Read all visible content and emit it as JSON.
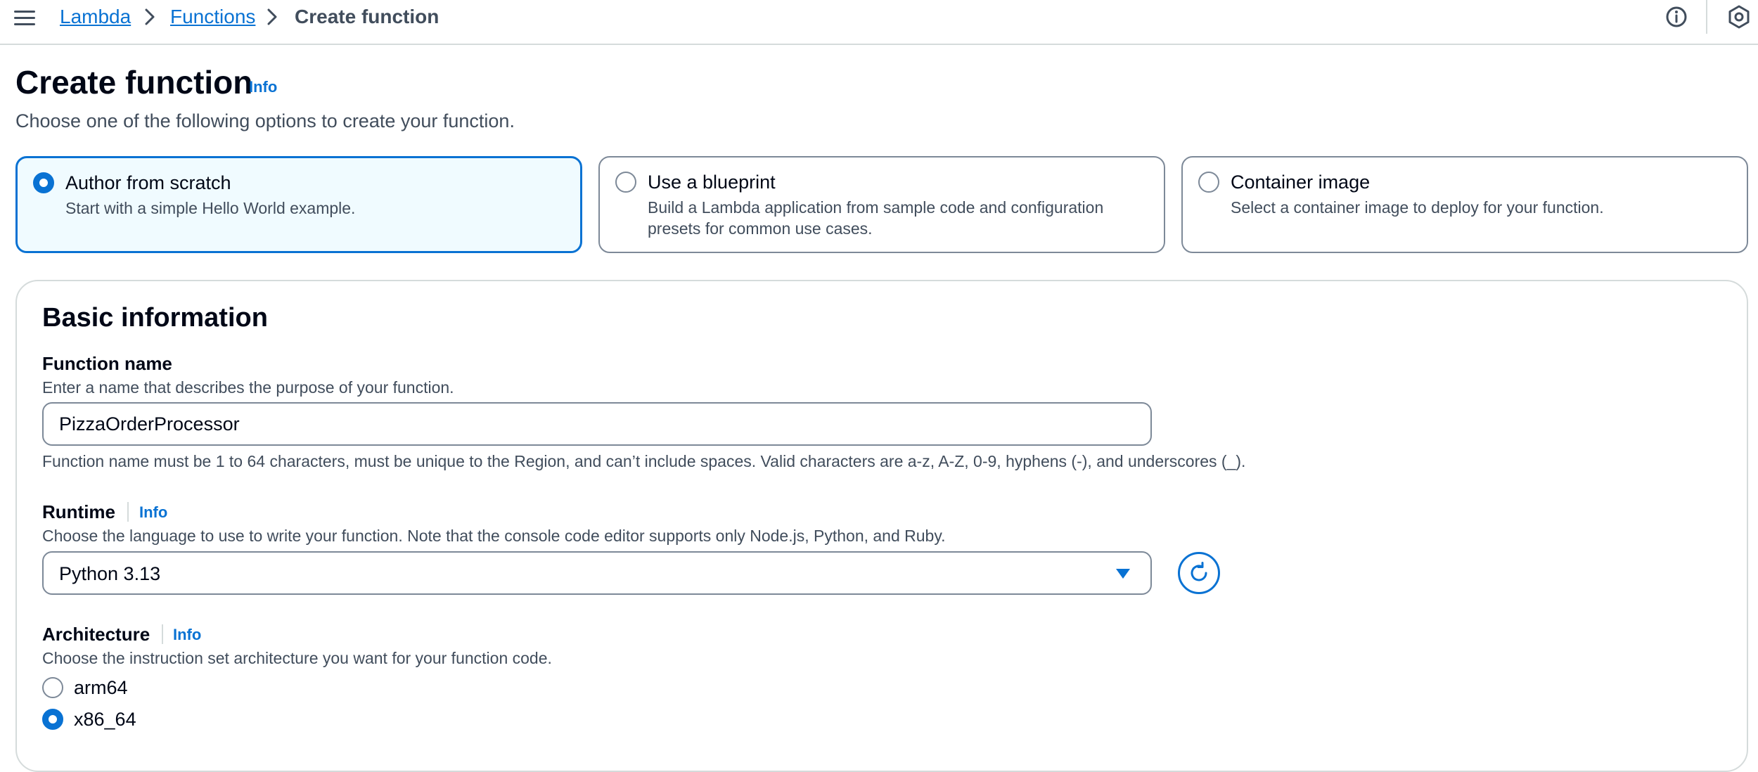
{
  "breadcrumb": {
    "items": [
      "Lambda",
      "Functions"
    ],
    "current": "Create function"
  },
  "header": {
    "title": "Create function",
    "info": "Info",
    "subtitle": "Choose one of the following options to create your function."
  },
  "options": [
    {
      "title": "Author from scratch",
      "description": "Start with a simple Hello World example.",
      "selected": true
    },
    {
      "title": "Use a blueprint",
      "description": "Build a Lambda application from sample code and configuration presets for common use cases.",
      "selected": false
    },
    {
      "title": "Container image",
      "description": "Select a container image to deploy for your function.",
      "selected": false
    }
  ],
  "basic_info": {
    "title": "Basic information",
    "function_name": {
      "label": "Function name",
      "description": "Enter a name that describes the purpose of your function.",
      "value": "PizzaOrderProcessor",
      "constraint": "Function name must be 1 to 64 characters, must be unique to the Region, and can’t include spaces. Valid characters are a-z, A-Z, 0-9, hyphens (-), and underscores (_)."
    },
    "runtime": {
      "label": "Runtime",
      "info": "Info",
      "description": "Choose the language to use to write your function. Note that the console code editor supports only Node.js, Python, and Ruby.",
      "value": "Python 3.13"
    },
    "architecture": {
      "label": "Architecture",
      "info": "Info",
      "description": "Choose the instruction set architecture you want for your function code.",
      "options": [
        {
          "label": "arm64",
          "selected": false
        },
        {
          "label": "x86_64",
          "selected": true
        }
      ]
    }
  },
  "icons": {
    "menu": "hamburger-menu-icon",
    "breadcrumb_separator": "chevron-right-icon",
    "help": "info-circle-icon",
    "settings": "hexagon-settings-icon",
    "dropdown": "caret-down-icon",
    "refresh": "refresh-icon"
  },
  "colors": {
    "accent": "#0972d3",
    "selected_tile_bg": "#f0fbff",
    "text": "#000716",
    "secondary_text": "#414d5c",
    "border": "#7d8998"
  }
}
